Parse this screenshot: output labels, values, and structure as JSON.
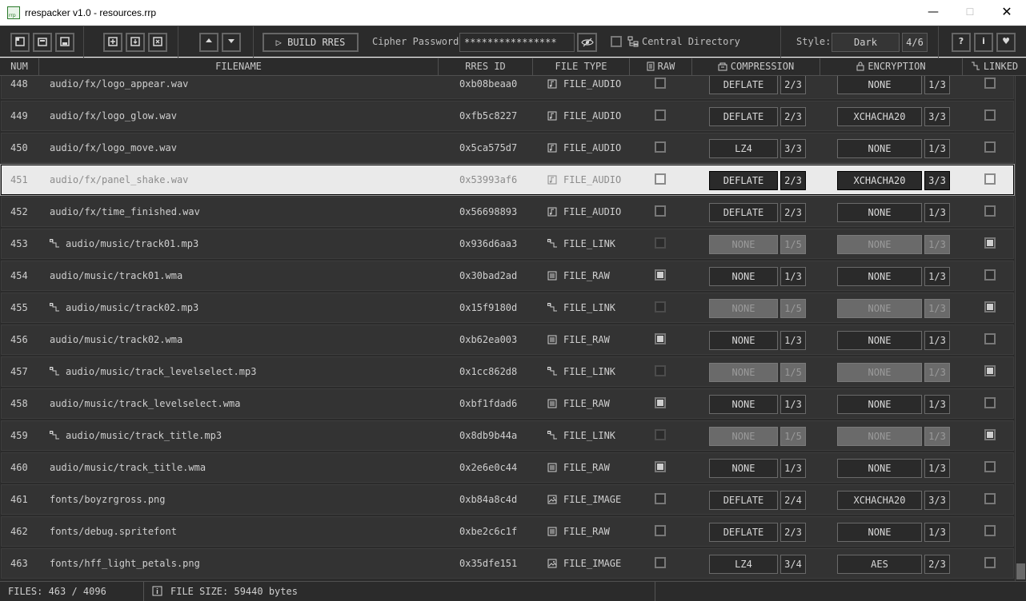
{
  "window": {
    "title": "rrespacker v1.0 - resources.rrp"
  },
  "toolbar": {
    "build_label": "BUILD RRES",
    "cipher_label": "Cipher Password:",
    "cipher_value": "****************",
    "central_dir_label": "Central Directory",
    "central_dir_checked": false,
    "style_label": "Style:",
    "style_value": "Dark",
    "style_count": "4/6",
    "help_label": "?",
    "info_label": "i"
  },
  "columns": {
    "num": "NUM",
    "filename": "FILENAME",
    "rres_id": "RRES ID",
    "file_type": "FILE TYPE",
    "raw": "RAW",
    "compression": "COMPRESSION",
    "encryption": "ENCRYPTION",
    "linked": "LINKED"
  },
  "rows": [
    {
      "num": "448",
      "filename": "audio/fx/logo_appear.wav",
      "id": "0xb08beaa0",
      "type": "FILE_AUDIO",
      "icon": "audio-file-icon",
      "raw": false,
      "linked": false,
      "link": false,
      "comp": "DEFLATE",
      "comp_n": "2/3",
      "enc": "NONE",
      "enc_n": "1/3",
      "selected": false
    },
    {
      "num": "449",
      "filename": "audio/fx/logo_glow.wav",
      "id": "0xfb5c8227",
      "type": "FILE_AUDIO",
      "icon": "audio-file-icon",
      "raw": false,
      "linked": false,
      "link": false,
      "comp": "DEFLATE",
      "comp_n": "2/3",
      "enc": "XCHACHA20",
      "enc_n": "3/3",
      "selected": false
    },
    {
      "num": "450",
      "filename": "audio/fx/logo_move.wav",
      "id": "0x5ca575d7",
      "type": "FILE_AUDIO",
      "icon": "audio-file-icon",
      "raw": false,
      "linked": false,
      "link": false,
      "comp": "LZ4",
      "comp_n": "3/3",
      "enc": "NONE",
      "enc_n": "1/3",
      "selected": false
    },
    {
      "num": "451",
      "filename": "audio/fx/panel_shake.wav",
      "id": "0x53993af6",
      "type": "FILE_AUDIO",
      "icon": "audio-file-icon",
      "raw": false,
      "linked": false,
      "link": false,
      "comp": "DEFLATE",
      "comp_n": "2/3",
      "enc": "XCHACHA20",
      "enc_n": "3/3",
      "selected": true
    },
    {
      "num": "452",
      "filename": "audio/fx/time_finished.wav",
      "id": "0x56698893",
      "type": "FILE_AUDIO",
      "icon": "audio-file-icon",
      "raw": false,
      "linked": false,
      "link": false,
      "comp": "DEFLATE",
      "comp_n": "2/3",
      "enc": "NONE",
      "enc_n": "1/3",
      "selected": false
    },
    {
      "num": "453",
      "filename": "audio/music/track01.mp3",
      "id": "0x936d6aa3",
      "type": "FILE_LINK",
      "icon": "link-icon",
      "raw": false,
      "linked": true,
      "link": true,
      "comp": "NONE",
      "comp_n": "1/5",
      "enc": "NONE",
      "enc_n": "1/3",
      "selected": false
    },
    {
      "num": "454",
      "filename": "audio/music/track01.wma",
      "id": "0x30bad2ad",
      "type": "FILE_RAW",
      "icon": "raw-file-icon",
      "raw": true,
      "linked": false,
      "link": false,
      "comp": "NONE",
      "comp_n": "1/3",
      "enc": "NONE",
      "enc_n": "1/3",
      "selected": false
    },
    {
      "num": "455",
      "filename": "audio/music/track02.mp3",
      "id": "0x15f9180d",
      "type": "FILE_LINK",
      "icon": "link-icon",
      "raw": false,
      "linked": true,
      "link": true,
      "comp": "NONE",
      "comp_n": "1/5",
      "enc": "NONE",
      "enc_n": "1/3",
      "selected": false
    },
    {
      "num": "456",
      "filename": "audio/music/track02.wma",
      "id": "0xb62ea003",
      "type": "FILE_RAW",
      "icon": "raw-file-icon",
      "raw": true,
      "linked": false,
      "link": false,
      "comp": "NONE",
      "comp_n": "1/3",
      "enc": "NONE",
      "enc_n": "1/3",
      "selected": false
    },
    {
      "num": "457",
      "filename": "audio/music/track_levelselect.mp3",
      "id": "0x1cc862d8",
      "type": "FILE_LINK",
      "icon": "link-icon",
      "raw": false,
      "linked": true,
      "link": true,
      "comp": "NONE",
      "comp_n": "1/5",
      "enc": "NONE",
      "enc_n": "1/3",
      "selected": false
    },
    {
      "num": "458",
      "filename": "audio/music/track_levelselect.wma",
      "id": "0xbf1fdad6",
      "type": "FILE_RAW",
      "icon": "raw-file-icon",
      "raw": true,
      "linked": false,
      "link": false,
      "comp": "NONE",
      "comp_n": "1/3",
      "enc": "NONE",
      "enc_n": "1/3",
      "selected": false
    },
    {
      "num": "459",
      "filename": "audio/music/track_title.mp3",
      "id": "0x8db9b44a",
      "type": "FILE_LINK",
      "icon": "link-icon",
      "raw": false,
      "linked": true,
      "link": true,
      "comp": "NONE",
      "comp_n": "1/5",
      "enc": "NONE",
      "enc_n": "1/3",
      "selected": false
    },
    {
      "num": "460",
      "filename": "audio/music/track_title.wma",
      "id": "0x2e6e0c44",
      "type": "FILE_RAW",
      "icon": "raw-file-icon",
      "raw": true,
      "linked": false,
      "link": false,
      "comp": "NONE",
      "comp_n": "1/3",
      "enc": "NONE",
      "enc_n": "1/3",
      "selected": false
    },
    {
      "num": "461",
      "filename": "fonts/boyzrgross.png",
      "id": "0xb84a8c4d",
      "type": "FILE_IMAGE",
      "icon": "image-file-icon",
      "raw": false,
      "linked": false,
      "link": false,
      "comp": "DEFLATE",
      "comp_n": "2/4",
      "enc": "XCHACHA20",
      "enc_n": "3/3",
      "selected": false
    },
    {
      "num": "462",
      "filename": "fonts/debug.spritefont",
      "id": "0xbe2c6c1f",
      "type": "FILE_RAW",
      "icon": "raw-file-icon",
      "raw": false,
      "linked": false,
      "link": false,
      "comp": "DEFLATE",
      "comp_n": "2/3",
      "enc": "NONE",
      "enc_n": "1/3",
      "selected": false
    },
    {
      "num": "463",
      "filename": "fonts/hff_light_petals.png",
      "id": "0x35dfe151",
      "type": "FILE_IMAGE",
      "icon": "image-file-icon",
      "raw": false,
      "linked": false,
      "link": false,
      "comp": "LZ4",
      "comp_n": "3/4",
      "enc": "AES",
      "enc_n": "2/3",
      "selected": false
    }
  ],
  "status": {
    "files": "FILES: 463 / 4096",
    "size": "FILE SIZE: 59440 bytes"
  },
  "colors": {
    "background": "#2b2b2b",
    "row": "#333333",
    "selected_row": "#eaeaea",
    "disabled_box": "#6a6a6a",
    "text": "#cfcfcf"
  }
}
